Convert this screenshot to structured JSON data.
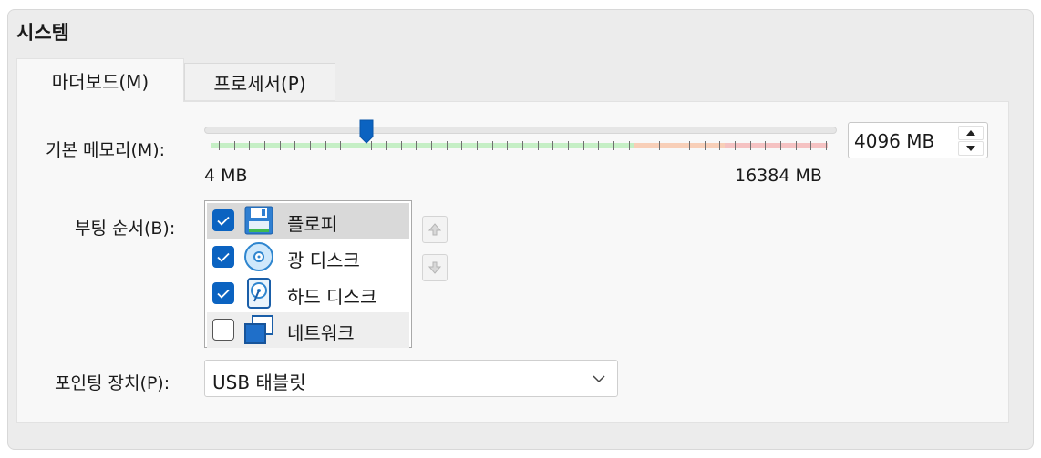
{
  "group_title": "시스템",
  "tabs": [
    {
      "label": "마더보드(M)",
      "active": true
    },
    {
      "label": "프로세서(P)",
      "active": false
    }
  ],
  "memory": {
    "label": "기본 메모리(M):",
    "value": "4096 MB",
    "slider_value_mb": 4096,
    "min_label": "4 MB",
    "max_label": "16384 MB"
  },
  "boot_order": {
    "label": "부팅 순서(B):",
    "items": [
      {
        "label": "플로피",
        "checked": true,
        "icon": "floppy-icon"
      },
      {
        "label": "광 디스크",
        "checked": true,
        "icon": "optical-disc-icon"
      },
      {
        "label": "하드 디스크",
        "checked": true,
        "icon": "hard-disk-icon"
      },
      {
        "label": "네트워크",
        "checked": false,
        "icon": "network-icon"
      }
    ]
  },
  "pointing_device": {
    "label": "포인팅 장치(P):",
    "value": "USB 태블릿"
  },
  "colors": {
    "accent": "#0b63c1",
    "slider_green": "#c5efc5",
    "slider_orange": "#f8cfb8",
    "slider_red": "#f5c2c2"
  }
}
